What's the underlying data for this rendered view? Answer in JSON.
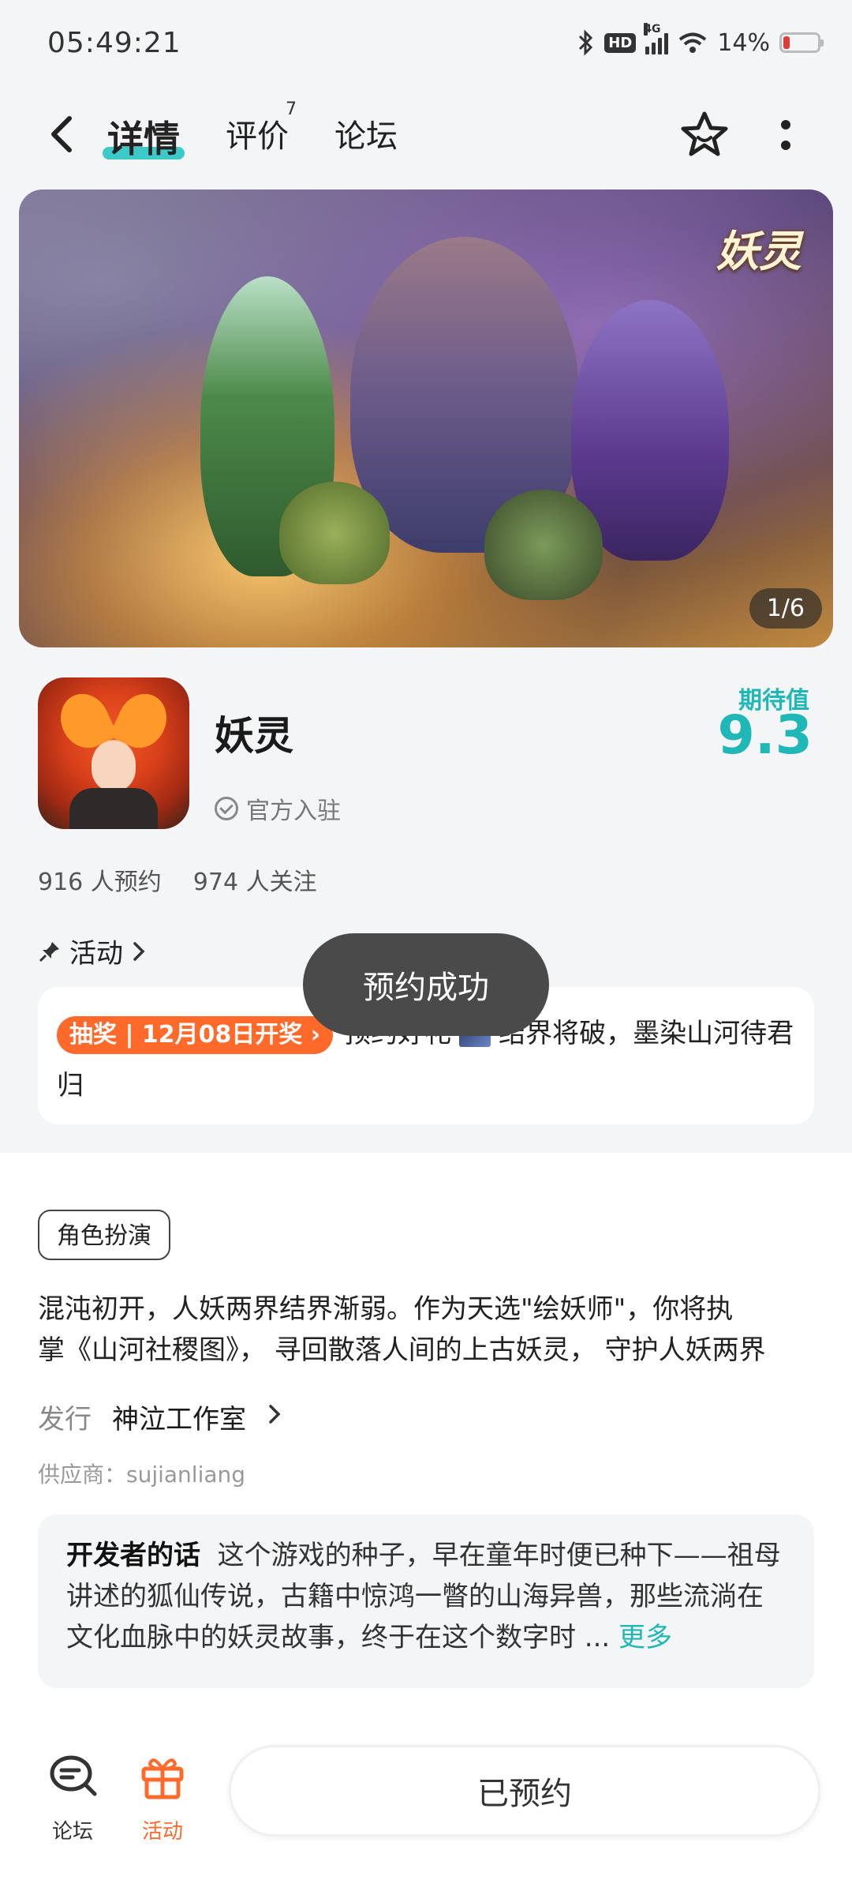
{
  "status": {
    "time": "05:49:21",
    "battery": "14%",
    "hd": "HD",
    "network": "4G"
  },
  "nav": {
    "tabs": [
      {
        "label": "详情"
      },
      {
        "label": "评价",
        "badge": "7"
      },
      {
        "label": "论坛"
      }
    ]
  },
  "banner": {
    "logo_text": "妖灵",
    "counter": "1/6"
  },
  "app": {
    "name": "妖灵",
    "official_label": "官方入驻",
    "expect_label": "期待值",
    "expect_score": "9.3",
    "reservations": "916 人预约",
    "followers": "974 人关注"
  },
  "activity": {
    "heading": "活动",
    "tag": "抽奖 | 12月08日开奖",
    "text_before_icon": "预约好礼",
    "text_after_icon": "结界将破，墨染山河待君归"
  },
  "toast": {
    "text": "预约成功"
  },
  "genre": "角色扮演",
  "description": {
    "line1": "混沌初开，人妖两界结界渐弱。作为天选\"绘妖师\"，你将执",
    "line2": "掌《山河社稷图》， 寻回散落人间的上古妖灵， 守护人妖两界"
  },
  "publisher": {
    "label": "发行",
    "value": "神泣工作室"
  },
  "supplier": "供应商：sujianliang",
  "developer": {
    "title": "开发者的话",
    "text": "这个游戏的种子，早在童年时便已种下——祖母讲述的狐仙传说，古籍中惊鸿一瞥的山海异兽，那些流淌在文化血脉中的妖灵故事，终于在这个数字时",
    "more": "更多"
  },
  "bottom": {
    "forum_label": "论坛",
    "activity_label": "活动",
    "reserve_button": "已预约"
  },
  "colors": {
    "accent": "#20b8b7",
    "orange": "#ff6a2b"
  }
}
